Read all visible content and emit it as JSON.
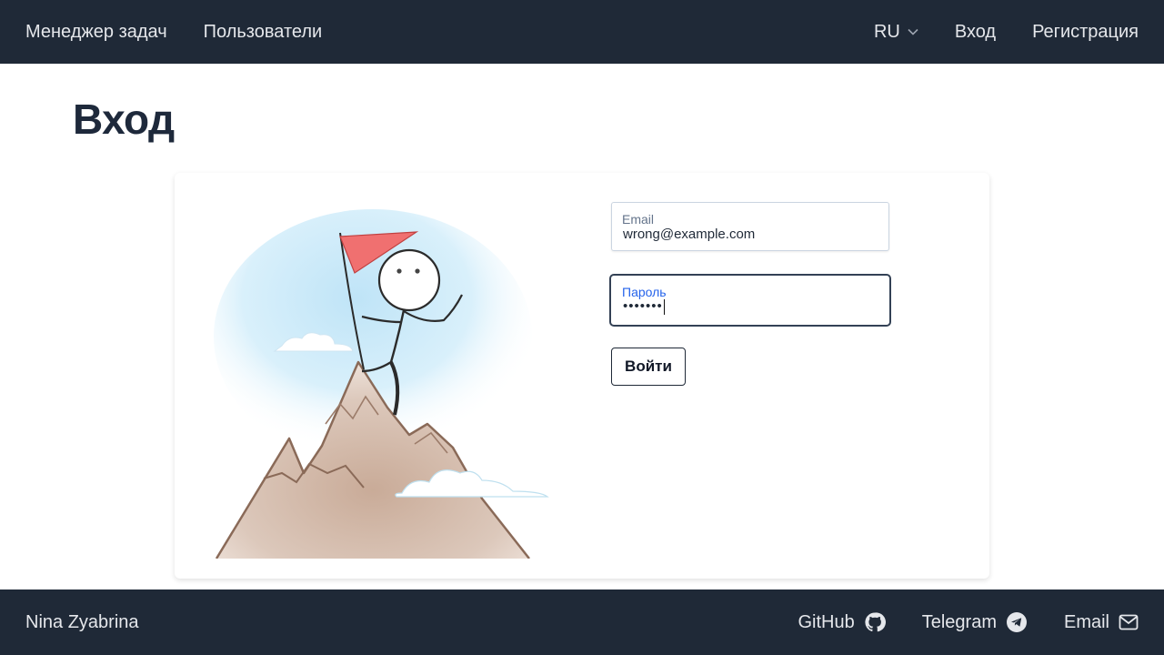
{
  "nav": {
    "brand": "Менеджер задач",
    "users": "Пользователи",
    "language": "RU",
    "login": "Вход",
    "register": "Регистрация"
  },
  "page": {
    "title": "Вход"
  },
  "form": {
    "email_label": "Email",
    "email_value": "wrong@example.com",
    "password_label": "Пароль",
    "password_mask": "•••••••",
    "submit_label": "Войти"
  },
  "footer": {
    "author": "Nina Zyabrina",
    "github": "GitHub",
    "telegram": "Telegram",
    "email": "Email"
  },
  "icons": {
    "language_dropdown": "chevron-down-icon",
    "github": "github-icon",
    "telegram": "telegram-icon",
    "email": "envelope-icon"
  },
  "colors": {
    "header_bg": "#1f2937",
    "accent_focus": "#2563eb",
    "text_dark": "#1e293b"
  }
}
